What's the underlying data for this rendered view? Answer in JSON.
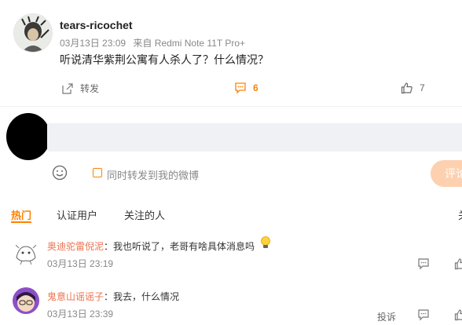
{
  "post": {
    "username": "tears-ricochet",
    "date": "03月13日 23:09",
    "source": "来自 Redmi Note 11T Pro+",
    "text": "听说清华紫荆公寓有人杀人了？什么情况？",
    "repost_label": "转发",
    "comment_count": "6",
    "like_count": "7"
  },
  "composer": {
    "sync_label": "同时转发到我的微博",
    "submit_label": "评论"
  },
  "tabs": {
    "items": [
      {
        "label": "热门"
      },
      {
        "label": "认证用户"
      },
      {
        "label": "关注的人"
      }
    ],
    "more": "关"
  },
  "replies": [
    {
      "name": "奥迪驼雷倪泥",
      "text": "：我也听说了，老哥有啥具体消息吗",
      "time": "03月13日 23:19"
    },
    {
      "name": "鬼意山谣谣子",
      "text": "：我去，什么情况",
      "time": "03月13日 23:39",
      "report_label": "投诉"
    }
  ],
  "colors": {
    "accent": "#ff8200",
    "name_link": "#eb7350",
    "input_bg": "#f0f1f4",
    "submit_bg": "#fdd0b0"
  }
}
